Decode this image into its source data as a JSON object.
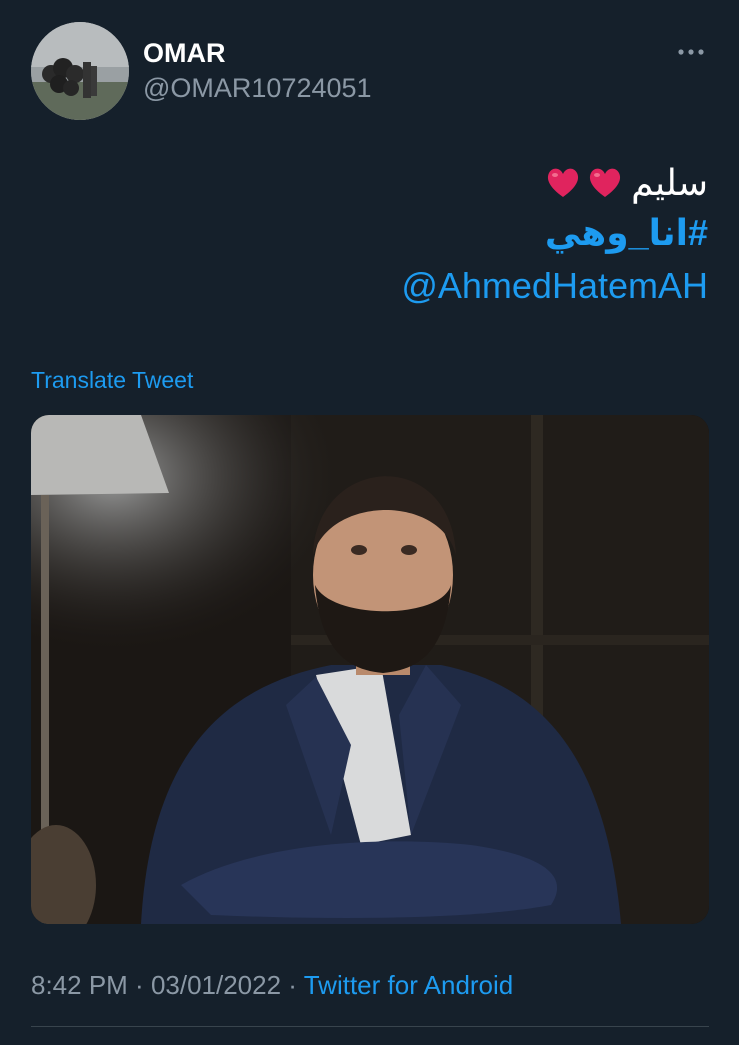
{
  "author": {
    "display_name": "OMAR",
    "handle": "@OMAR10724051",
    "avatar_icon": "avatar-image"
  },
  "more_icon": "more-horizontal-icon",
  "tweet": {
    "line1_text": "سليم",
    "line1_hearts": [
      "red-heart-emoji",
      "red-heart-emoji"
    ],
    "hashtag": "#انا_وهي",
    "mention": "@AhmedHatemAH"
  },
  "translate_label": "Translate Tweet",
  "media": {
    "description_icon": "photo"
  },
  "meta": {
    "time": "8:42 PM",
    "sep1": " · ",
    "date": "03/01/2022",
    "sep2": " · ",
    "source": "Twitter for Android"
  },
  "colors": {
    "background": "#15202b",
    "link": "#1d9bf0",
    "secondary": "#8b98a5",
    "heart": "#e0245e"
  }
}
